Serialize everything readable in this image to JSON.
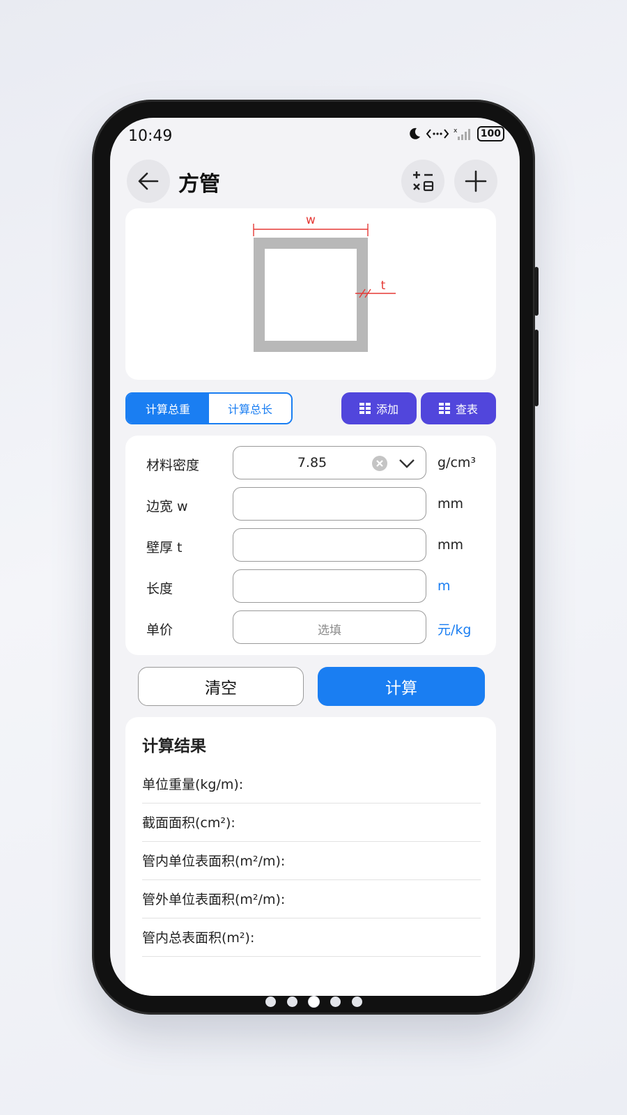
{
  "status": {
    "time": "10:49",
    "battery": "100"
  },
  "appbar": {
    "title": "方管"
  },
  "diagram": {
    "w_label": "w",
    "t_label": "t"
  },
  "mode_tabs": [
    {
      "label": "计算总重",
      "active": true
    },
    {
      "label": "计算总长",
      "active": false
    }
  ],
  "actions": {
    "add_label": "添加",
    "table_label": "查表"
  },
  "form": {
    "density": {
      "label": "材料密度",
      "value": "7.85",
      "unit": "g/cm³"
    },
    "width": {
      "label": "边宽 w",
      "value": "",
      "unit": "mm"
    },
    "thickness": {
      "label": "壁厚 t",
      "value": "",
      "unit": "mm"
    },
    "length": {
      "label": "长度",
      "value": "",
      "unit": "m"
    },
    "price": {
      "label": "单价",
      "placeholder": "选填",
      "unit": "元/kg"
    }
  },
  "buttons": {
    "clear": "清空",
    "calculate": "计算"
  },
  "results": {
    "title": "计算结果",
    "items": [
      "单位重量(kg/m):",
      "截面面积(cm²):",
      "管内单位表面积(m²/m):",
      "管外单位表面积(m²/m):",
      "管内总表面积(m²):"
    ]
  },
  "pager": {
    "count": 5,
    "active_index": 2
  },
  "colors": {
    "accent": "#1a7ef2",
    "purple": "#5146dc",
    "dimension_red": "#e53935"
  }
}
